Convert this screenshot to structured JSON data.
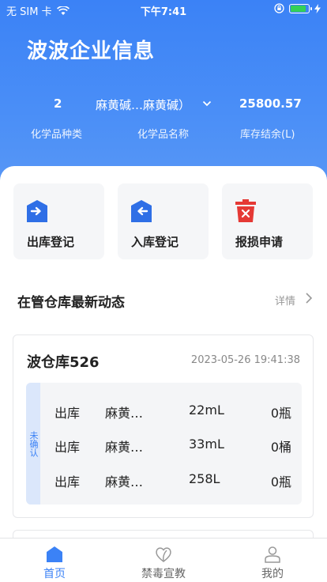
{
  "status_bar": {
    "carrier": "无 SIM 卡",
    "time": "下午7:41"
  },
  "header": {
    "company_title": "波波企业信息",
    "stats": [
      {
        "value": "2",
        "label": "化学品种类"
      },
      {
        "value": "麻黄碱…麻黄碱）",
        "label": "化学品名称"
      },
      {
        "value": "25800.57",
        "label": "库存结余(L)"
      }
    ]
  },
  "actions": [
    {
      "label": "出库登记",
      "icon": "outbound-icon"
    },
    {
      "label": "入库登记",
      "icon": "inbound-icon"
    },
    {
      "label": "报损申请",
      "icon": "trash-report-icon"
    }
  ],
  "section": {
    "title": "在管仓库最新动态",
    "more": "详情"
  },
  "warehouse": {
    "name": "波仓库526",
    "time": "2023-05-26 19:41:38",
    "status": "未确认",
    "rows": [
      {
        "type": "出库",
        "name": "麻黄…",
        "amount": "22mL",
        "count": "0瓶"
      },
      {
        "type": "出库",
        "name": "麻黄…",
        "amount": "33mL",
        "count": "0桶"
      },
      {
        "type": "出库",
        "name": "麻黄…",
        "amount": "258L",
        "count": "0瓶"
      }
    ]
  },
  "tabbar": {
    "items": [
      {
        "label": "首页",
        "active": true
      },
      {
        "label": "禁毒宣教",
        "active": false
      },
      {
        "label": "我的",
        "active": false
      }
    ]
  },
  "colors": {
    "primary": "#3b82f6",
    "danger": "#e53935",
    "battery": "#34d058"
  },
  "battery_level": 0.9
}
